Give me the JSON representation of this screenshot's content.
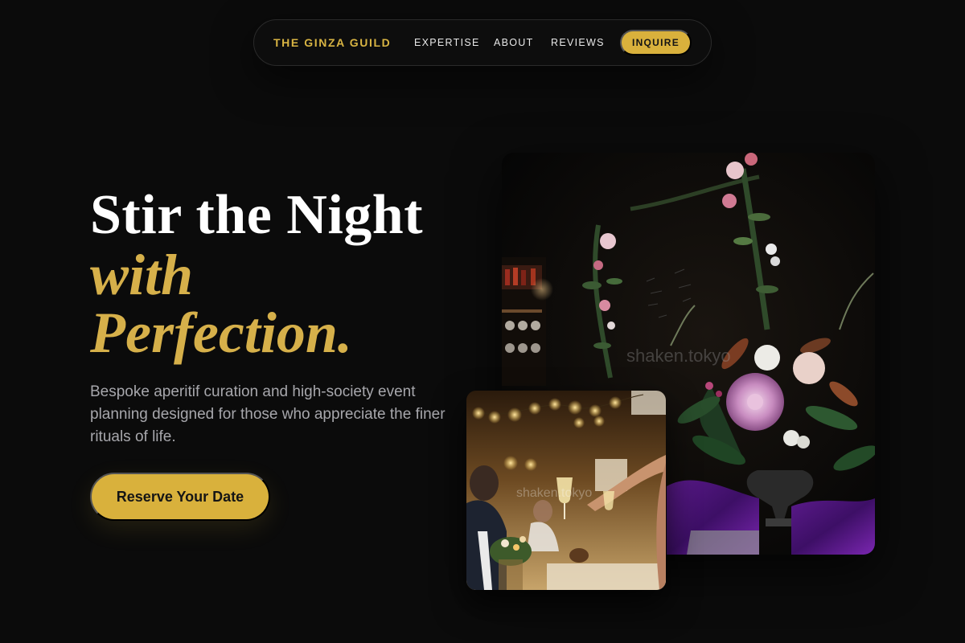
{
  "nav": {
    "brand": "THE GINZA GUILD",
    "links": [
      "EXPERTISE",
      "ABOUT",
      "REVIEWS"
    ],
    "cta": "INQUIRE"
  },
  "hero": {
    "title_line1": "Stir the Night",
    "title_line2": "with",
    "title_line3": "Perfection.",
    "subtitle": "Bespoke aperitif curation and high-society event planning designed for those who appreciate the finer rituals of life.",
    "cta": "Reserve Your Date"
  },
  "images": {
    "main_watermark": "shaken.tokyo",
    "small_watermark": "shaken.tokyo"
  },
  "colors": {
    "background": "#0b0b0b",
    "accent_gold": "#d9b13c",
    "title_gold": "#d6b04a",
    "subtitle_gray": "#a7a7ac"
  }
}
